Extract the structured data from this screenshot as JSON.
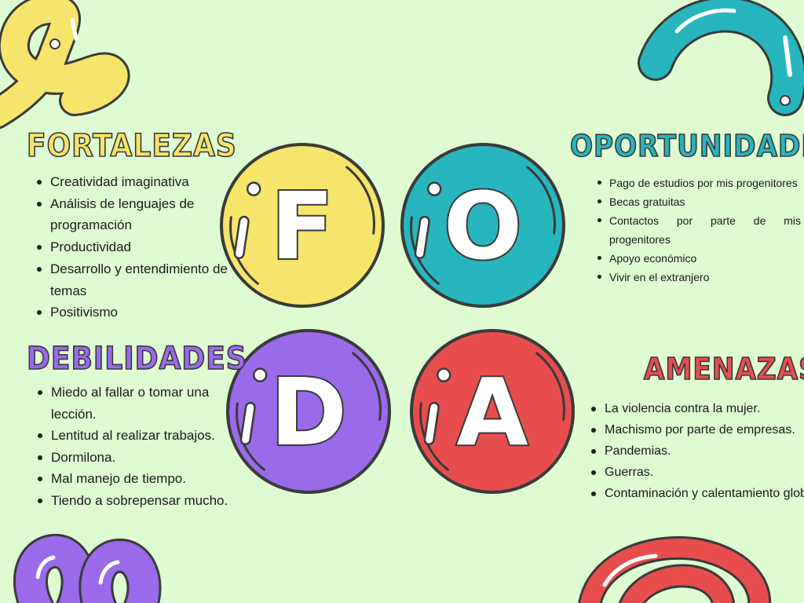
{
  "colors": {
    "background": "#defbd2",
    "yellow": "#f7e46a",
    "teal": "#27b6bd",
    "purple": "#9a6aea",
    "red": "#e84d4d",
    "outline": "#3a3a3a"
  },
  "circles": [
    {
      "letter": "F",
      "color": "#f7e46a"
    },
    {
      "letter": "O",
      "color": "#27b6bd"
    },
    {
      "letter": "D",
      "color": "#9a6aea"
    },
    {
      "letter": "A",
      "color": "#e84d4d"
    }
  ],
  "fortalezas": {
    "title": "FORTALEZAS",
    "items": [
      "Creatividad imaginativa",
      "Análisis de lenguajes de programación",
      "Productividad",
      "Desarrollo y entendimiento de temas",
      "Positivismo"
    ]
  },
  "oportunidades": {
    "title": "OPORTUNIDADES",
    "items": [
      "Pago de estudios por mis progenitores",
      "Becas gratuitas",
      "Contactos por parte de mis progenitores",
      "Apoyo económico",
      "Vivir en el extranjero"
    ]
  },
  "debilidades": {
    "title": "DEBILIDADES",
    "items": [
      "Miedo al fallar o tomar una lección.",
      "Lentitud al realizar trabajos.",
      "Dormilona.",
      "Mal manejo de tiempo.",
      "Tiendo a sobrepensar mucho."
    ]
  },
  "amenazas": {
    "title": "AMENAZAS",
    "items": [
      "La violencia contra la mujer.",
      "Machismo por parte de empresas.",
      "Pandemias.",
      "Guerras.",
      "Contaminación y calentamiento global."
    ]
  }
}
